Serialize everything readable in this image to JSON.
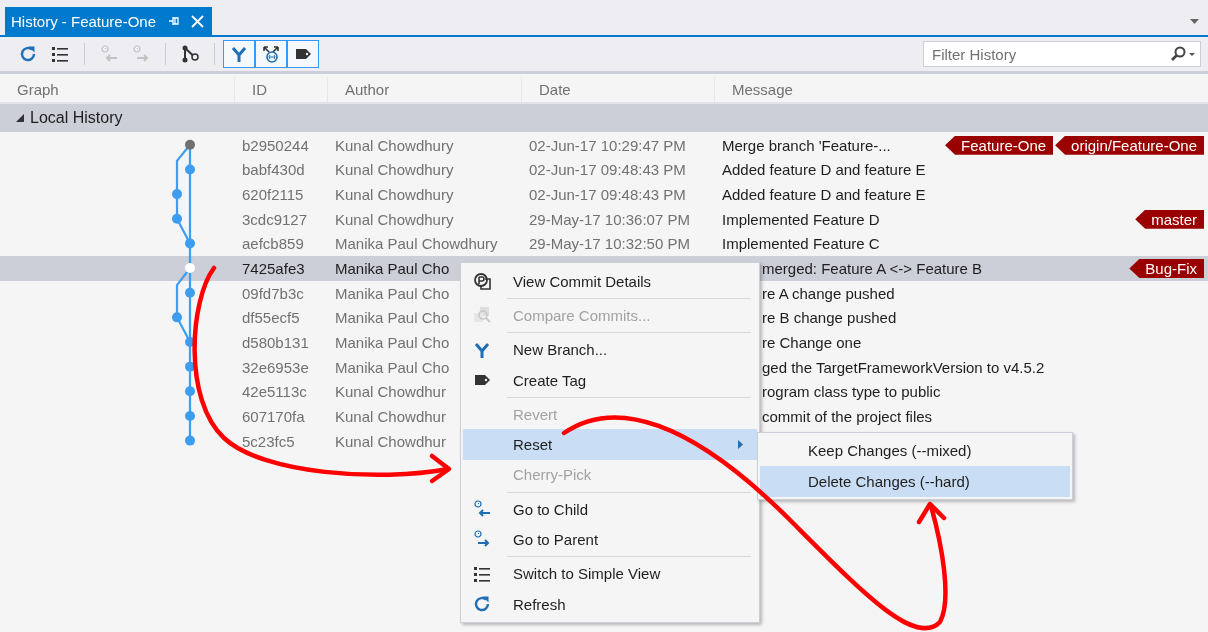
{
  "tab": {
    "title": "History - Feature-One"
  },
  "toolbar_groups": [
    [
      {
        "disabled": false,
        "on": false
      },
      {
        "disabled": false,
        "on": false
      }
    ],
    [
      {
        "disabled": true,
        "on": false
      },
      {
        "disabled": true,
        "on": false
      }
    ],
    [
      {
        "disabled": false,
        "on": false
      }
    ],
    [
      {
        "disabled": false,
        "on": true
      },
      {
        "disabled": false,
        "on": true
      },
      {
        "disabled": false,
        "on": true
      }
    ]
  ],
  "filter": {
    "placeholder": "Filter History"
  },
  "columns": [
    "Graph",
    "ID",
    "Author",
    "Date",
    "Message"
  ],
  "group": {
    "label": "Local History",
    "expanded": true
  },
  "rows": [
    {
      "id": "b2950244",
      "author": "Kunal Chowdhury",
      "date": "02-Jun-17 10:29:47 PM",
      "message": "Merge branch 'Feature-...",
      "tags": [
        "Feature-One",
        "origin/Feature-One"
      ],
      "selected": false,
      "kind": "full"
    },
    {
      "id": "babf430d",
      "author": "Kunal Chowdhury",
      "date": "02-Jun-17 09:48:43 PM",
      "message": "Added feature D and feature E",
      "tags": [],
      "selected": false,
      "kind": "full"
    },
    {
      "id": "620f2115",
      "author": "Kunal Chowdhury",
      "date": "02-Jun-17 09:48:43 PM",
      "message": "Added feature D and feature E",
      "tags": [],
      "selected": false,
      "kind": "full"
    },
    {
      "id": "3cdc9127",
      "author": "Kunal Chowdhury",
      "date": "29-May-17 10:36:07 PM",
      "message": "Implemented Feature D",
      "tags": [
        "master"
      ],
      "selected": false,
      "kind": "full"
    },
    {
      "id": "aefcb859",
      "author": "Manika Paul Chowdhury",
      "date": "29-May-17 10:32:50 PM",
      "message": "Implemented Feature C",
      "tags": [],
      "selected": false,
      "kind": "full"
    },
    {
      "id": "7425afe3",
      "author": "Manika Paul Cho",
      "message": "merged: Feature A <-> Feature B",
      "tags": [
        "Bug-Fix"
      ],
      "selected": true,
      "kind": "behind_menu"
    },
    {
      "id": "09fd7b3c",
      "author": "Manika Paul Cho",
      "message": "re A change pushed",
      "tags": [],
      "selected": false,
      "kind": "behind_menu"
    },
    {
      "id": "df55ecf5",
      "author": "Manika Paul Cho",
      "message": "re B change pushed",
      "tags": [],
      "selected": false,
      "kind": "behind_menu"
    },
    {
      "id": "d580b131",
      "author": "Manika Paul Cho",
      "message": "re Change one",
      "tags": [],
      "selected": false,
      "kind": "behind_menu"
    },
    {
      "id": "32e6953e",
      "author": "Manika Paul Cho",
      "message": "ged the TargetFrameworkVersion to v4.5.2",
      "tags": [],
      "selected": false,
      "kind": "behind_menu"
    },
    {
      "id": "42e5113c",
      "author": "Kunal Chowdhur",
      "message": "rogram class type to public",
      "tags": [],
      "selected": false,
      "kind": "behind_menu"
    },
    {
      "id": "607170fa",
      "author": "Kunal Chowdhur",
      "message": "commit of the project files",
      "tags": [],
      "selected": false,
      "kind": "behind_menu"
    },
    {
      "id": "5c23fc5",
      "author": "Kunal Chowdhur",
      "tags": [],
      "selected": false,
      "kind": "behind_menu"
    }
  ],
  "context_menu": {
    "items": [
      {
        "label": "View Commit Details",
        "disabled": false,
        "selected": false,
        "submenu": false,
        "separator_after": true
      },
      {
        "label": "Compare Commits...",
        "disabled": true,
        "selected": false,
        "submenu": false,
        "separator_after": true
      },
      {
        "label": "New Branch...",
        "disabled": false,
        "selected": false,
        "submenu": false,
        "separator_after": false
      },
      {
        "label": "Create Tag",
        "disabled": false,
        "selected": false,
        "submenu": false,
        "separator_after": true
      },
      {
        "label": "Revert",
        "disabled": true,
        "selected": false,
        "submenu": false,
        "separator_after": false
      },
      {
        "label": "Reset",
        "disabled": false,
        "selected": true,
        "submenu": true,
        "separator_after": false
      },
      {
        "label": "Cherry-Pick",
        "disabled": true,
        "selected": false,
        "submenu": false,
        "separator_after": true
      },
      {
        "label": "Go to Child",
        "disabled": false,
        "selected": false,
        "submenu": false,
        "separator_after": false
      },
      {
        "label": "Go to Parent",
        "disabled": false,
        "selected": false,
        "submenu": false,
        "separator_after": true
      },
      {
        "label": "Switch to Simple View",
        "disabled": false,
        "selected": false,
        "submenu": false,
        "separator_after": false
      },
      {
        "label": "Refresh",
        "disabled": false,
        "selected": false,
        "submenu": false,
        "separator_after": false
      }
    ],
    "submenu": {
      "items": [
        {
          "label": "Keep Changes (--mixed)",
          "selected": false
        },
        {
          "label": "Delete Changes (--hard)",
          "selected": true
        }
      ]
    }
  }
}
